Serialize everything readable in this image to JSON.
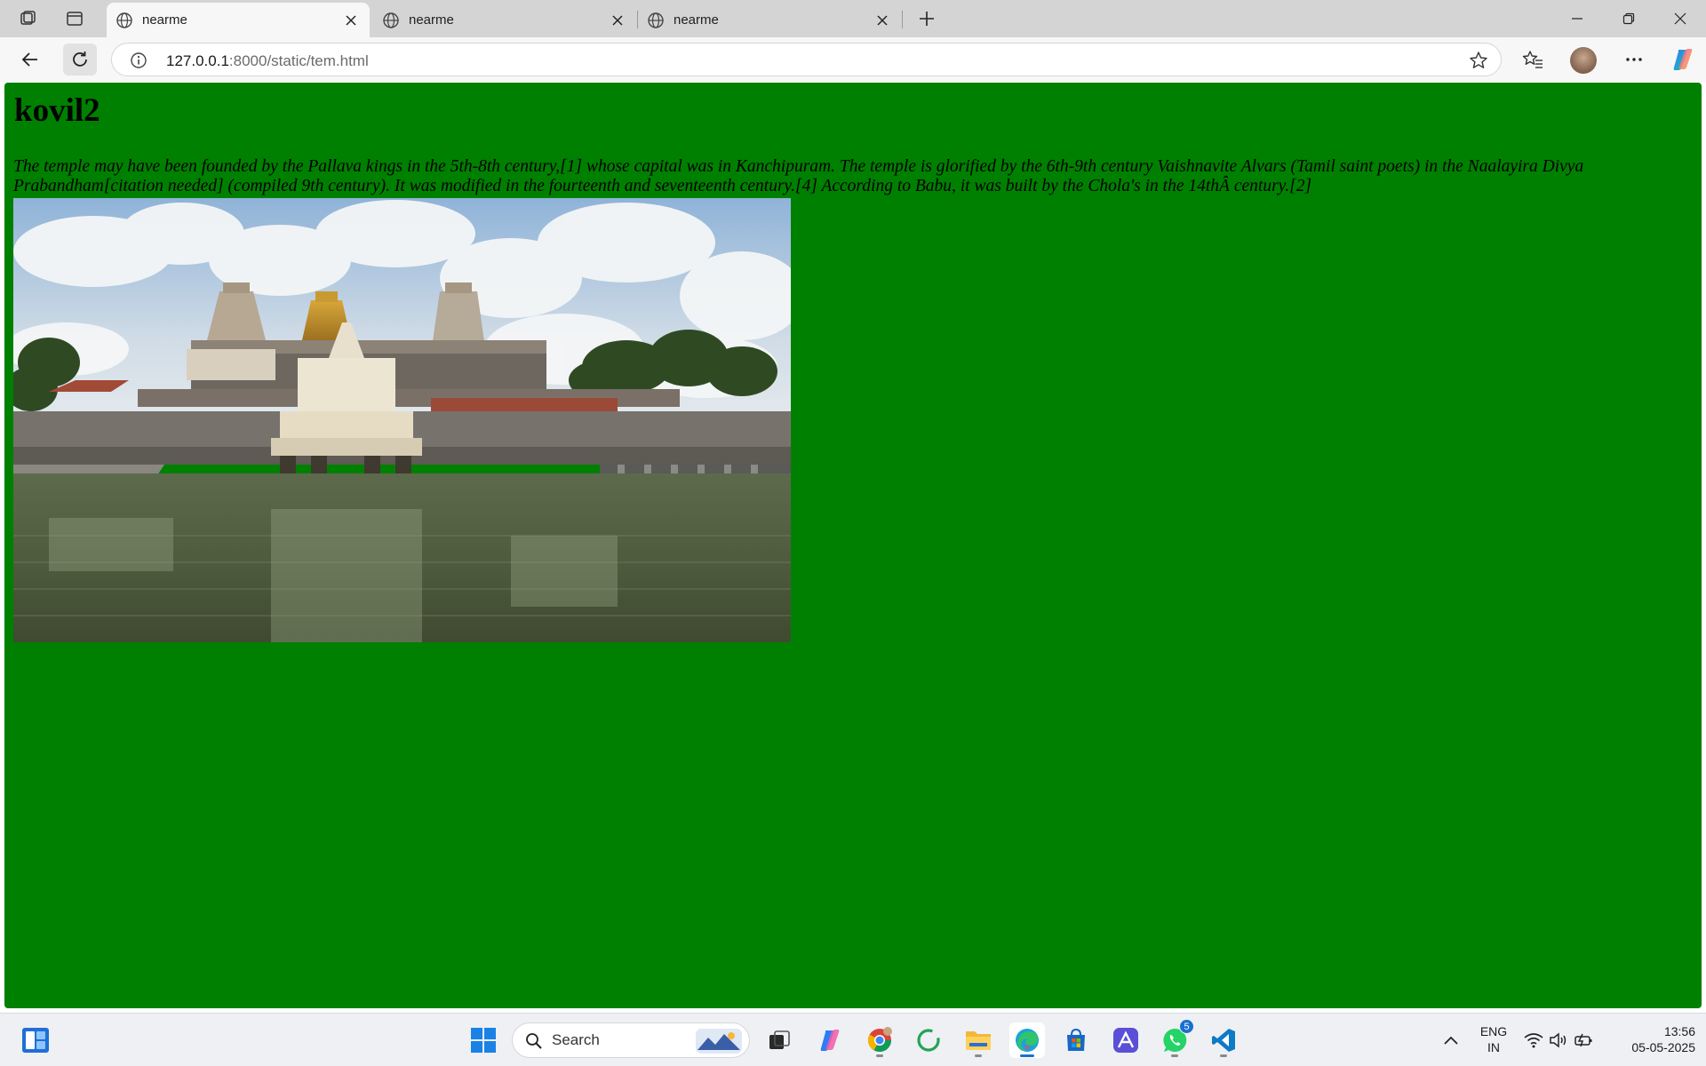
{
  "browser": {
    "tabs": [
      {
        "title": "nearme",
        "active": true
      },
      {
        "title": "nearme",
        "active": false
      },
      {
        "title": "nearme",
        "active": false
      }
    ],
    "address": {
      "host": "127.0.0.1",
      "path": ":8000/static/tem.html"
    }
  },
  "page": {
    "heading": "kovil2",
    "paragraph": "The temple may have been founded by the Pallava kings in the 5th-8th century,[1] whose capital was in Kanchipuram. The temple is glorified by the 6th-9th century Vaishnavite Alvars (Tamil saint poets) in the Naalayira Divya Prabandham[citation needed] (compiled 9th century). It was modified in the fourteenth and seventeenth century.[4] According to Babu, it was built by the Chola's in the 14thÂ century.[2]",
    "background_color": "#008000"
  },
  "taskbar": {
    "search_label": "Search",
    "whatsapp_badge": "5",
    "language_line1": "ENG",
    "language_line2": "IN",
    "time": "13:56",
    "date": "05-05-2025"
  }
}
